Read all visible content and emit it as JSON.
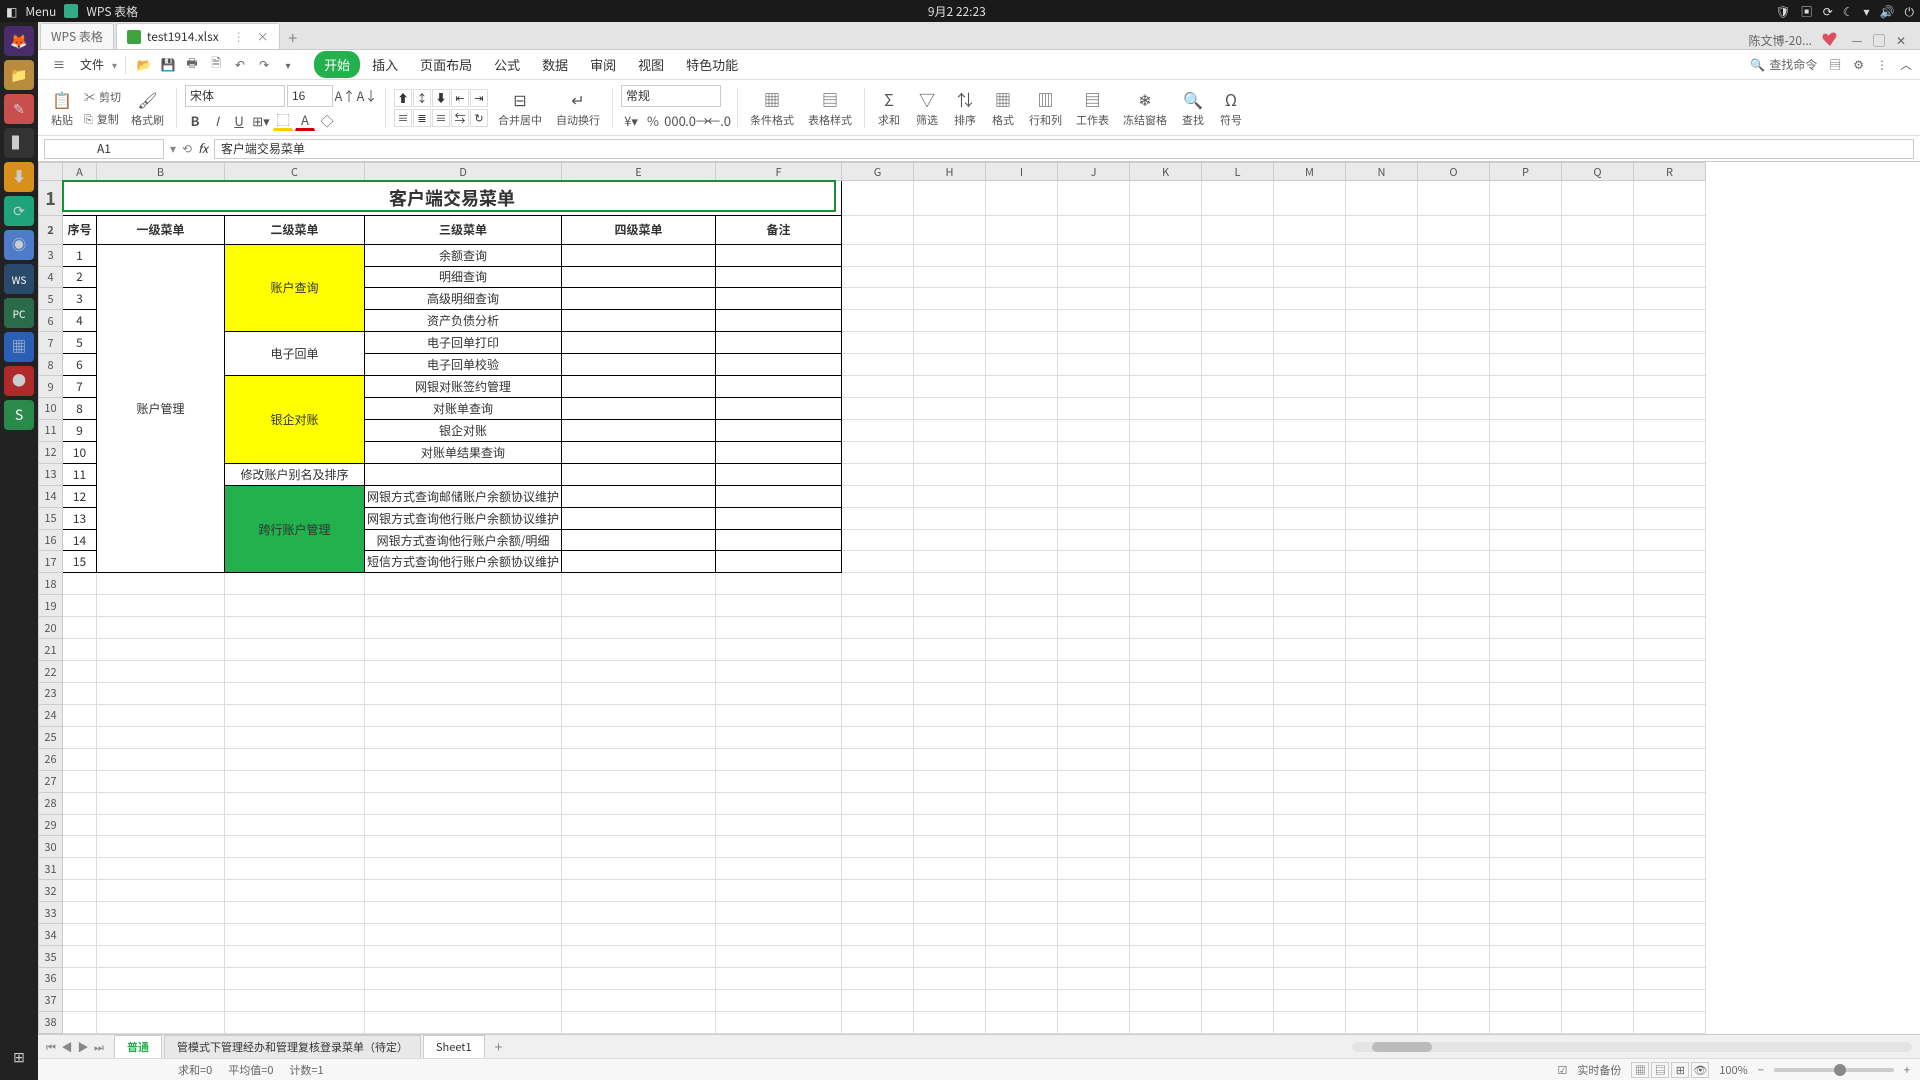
{
  "system": {
    "menu_label": "Menu",
    "app_name": "WPS 表格",
    "datetime": "9月2  22:23"
  },
  "titlebar": {
    "home_tab": "WPS 表格",
    "file_tab": "test1914.xlsx",
    "user": "陈文博-20...",
    "plus": "+"
  },
  "menu": {
    "file": "文件",
    "items": [
      "开始",
      "插入",
      "页面布局",
      "公式",
      "数据",
      "审阅",
      "视图",
      "特色功能"
    ],
    "search": "查找命令"
  },
  "ribbon": {
    "paste": "粘贴",
    "cut": "剪切",
    "copy": "复制",
    "fmtpainter": "格式刷",
    "font": "宋体",
    "size": "16",
    "merge": "合并居中",
    "wrap": "自动换行",
    "numfmt": "常规",
    "condfmt": "条件格式",
    "tablestyle": "表格样式",
    "sum": "求和",
    "filter": "筛选",
    "sort": "排序",
    "format": "格式",
    "rowcol": "行和列",
    "worksheet": "工作表",
    "freeze": "冻结窗格",
    "find": "查找",
    "symbol": "符号"
  },
  "formula": {
    "cellref": "A1",
    "content": "客户端交易菜单"
  },
  "columns": [
    "A",
    "B",
    "C",
    "D",
    "E",
    "F",
    "G",
    "H",
    "I",
    "J",
    "K",
    "L",
    "M",
    "N",
    "O",
    "P",
    "Q",
    "R"
  ],
  "data": {
    "title": "客户端交易菜单",
    "headers": {
      "seq": "序号",
      "l1": "一级菜单",
      "l2": "二级菜单",
      "l3": "三级菜单",
      "l4": "四级菜单",
      "note": "备注"
    },
    "l1": "账户管理",
    "l2": {
      "g1": "账户查询",
      "g2": "电子回单",
      "g3": "银企对账",
      "g4": "修改账户别名及排序",
      "g5": "跨行账户管理"
    },
    "rows": [
      {
        "n": 1,
        "l3": "余额查询"
      },
      {
        "n": 2,
        "l3": "明细查询"
      },
      {
        "n": 3,
        "l3": "高级明细查询"
      },
      {
        "n": 4,
        "l3": "资产负债分析"
      },
      {
        "n": 5,
        "l3": "电子回单打印"
      },
      {
        "n": 6,
        "l3": "电子回单校验"
      },
      {
        "n": 7,
        "l3": "网银对账签约管理"
      },
      {
        "n": 8,
        "l3": "对账单查询"
      },
      {
        "n": 9,
        "l3": "银企对账"
      },
      {
        "n": 10,
        "l3": "对账单结果查询"
      },
      {
        "n": 11,
        "l3": ""
      },
      {
        "n": 12,
        "l3": "网银方式查询邮储账户余额协议维护"
      },
      {
        "n": 13,
        "l3": "网银方式查询他行账户余额协议维护"
      },
      {
        "n": 14,
        "l3": "网银方式查询他行账户余额/明细"
      },
      {
        "n": 15,
        "l3": "短信方式查询他行账户余额协议维护"
      }
    ]
  },
  "sheets": {
    "normal": "普通",
    "long": "管模式下管理经办和管理复核登录菜单（待定）",
    "s1": "Sheet1"
  },
  "status": {
    "sum": "求和=0",
    "avg": "平均值=0",
    "count": "计数=1",
    "backup": "实时备份",
    "zoom": "100%"
  }
}
